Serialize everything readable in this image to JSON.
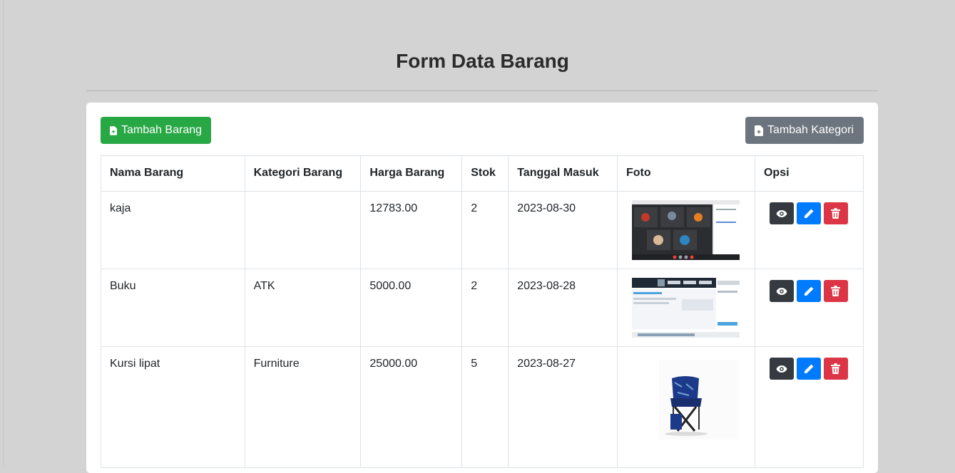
{
  "page": {
    "title": "Form Data Barang"
  },
  "toolbar": {
    "add_item_label": "Tambah Barang",
    "add_category_label": "Tambah Kategori"
  },
  "table": {
    "headers": [
      "Nama Barang",
      "Kategori Barang",
      "Harga Barang",
      "Stok",
      "Tanggal Masuk",
      "Foto",
      "Opsi"
    ],
    "rows": [
      {
        "nama": "kaja",
        "kategori": "",
        "harga": "12783.00",
        "stok": "2",
        "tanggal": "2023-08-30",
        "foto": "video-call-screenshot"
      },
      {
        "nama": "Buku",
        "kategori": "ATK",
        "harga": "5000.00",
        "stok": "2",
        "tanggal": "2023-08-28",
        "foto": "web-app-screenshot"
      },
      {
        "nama": "Kursi lipat",
        "kategori": "Furniture",
        "harga": "25000.00",
        "stok": "5",
        "tanggal": "2023-08-27",
        "foto": "folding-chair-photo"
      }
    ]
  },
  "icons": {
    "add": "file-plus-icon",
    "view": "eye-icon",
    "edit": "pencil-icon",
    "delete": "trash-icon"
  },
  "colors": {
    "success": "#28a745",
    "secondary": "#6c757d",
    "dark": "#343a40",
    "primary": "#007bff",
    "danger": "#dc3545",
    "background": "#d3d3d3"
  }
}
